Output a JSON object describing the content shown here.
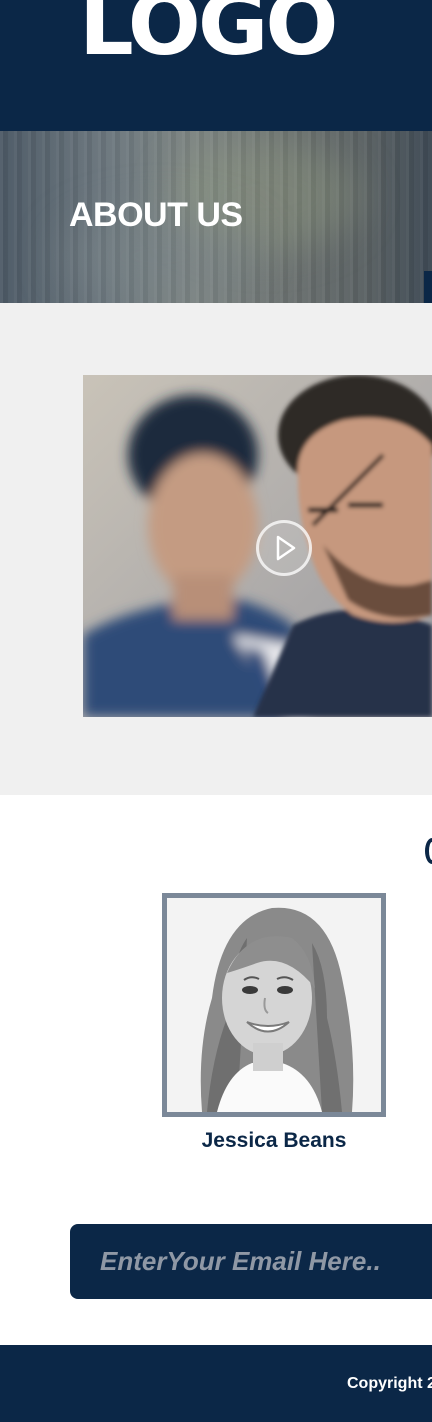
{
  "header": {
    "logo_text": "LOGO"
  },
  "banner": {
    "title": "ABOUT US"
  },
  "video": {
    "image": "business-men-photo",
    "play_icon": "play-icon"
  },
  "team": {
    "members": [
      {
        "name": "Jessica Beans",
        "photo": "woman-portrait-photo"
      }
    ]
  },
  "subscribe": {
    "email_placeholder": "EnterYour Email Here.."
  },
  "footer": {
    "copyright": "Copyright 2"
  },
  "colors": {
    "navy": "#0b2747",
    "light_gray": "#f0f0f0",
    "frame_gray": "#7b8898",
    "placeholder_gray": "#8f98a5"
  }
}
